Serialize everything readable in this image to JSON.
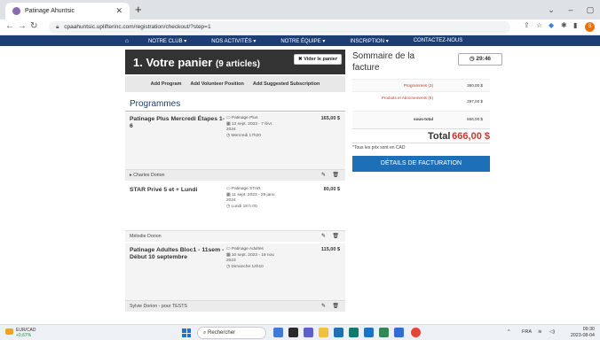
{
  "browser": {
    "tab_title": "Patinage Ahuntsic",
    "url": "cpaahuntsic.uplifterinc.com/registration/checkout/?step=1",
    "profile_initial": "S"
  },
  "site_nav": {
    "items": [
      "NOTRE CLUB",
      "NOS ACTIVITÉS",
      "NOTRE ÉQUIPE",
      "INSCRIPTION",
      "CONTACTEZ-NOUS"
    ],
    "dropdown_marker": "▾"
  },
  "cart": {
    "title": "1. Votre panier",
    "count": "(9 articles)",
    "empty_label": "Vider le panier",
    "actions": [
      "Add Program",
      "Add Volunteer Position",
      "Add Suggested Subscription"
    ],
    "section_title": "Programmes"
  },
  "programs": [
    {
      "name": "Patinage Plus Mercredi Étapes 1-6",
      "category": "Patinage Plus",
      "dates": "13 sept. 2023 - 7 févr. 2024",
      "schedule": "Mercredi 17h20",
      "price": "165,00 $",
      "person": "Charles Dorion",
      "has_toggle": true
    },
    {
      "name": "STAR Privé 5 et + Lundi",
      "category": "Patinage STAR",
      "dates": "11 sept. 2023 - 29 janv. 2024",
      "schedule": "Lundi 19 h 00",
      "price": "80,00 $",
      "person": "Mélodie Dorion",
      "has_toggle": false
    },
    {
      "name": "Patinage Adultes Bloc1 - 11sem - Début 10 septembre",
      "category": "Patinage Adultes",
      "dates": "10 sept. 2023 - 19 nov. 2023",
      "schedule": "Dimanche 14h10",
      "price": "115,00 $",
      "person": "Sylvie Dorion - pour TESTS",
      "has_toggle": false
    }
  ],
  "summary": {
    "title": "Sommaire de la facture",
    "timer": "29:46",
    "rows": [
      {
        "label": "Programmes (3)",
        "value": "360,00 $"
      },
      {
        "label": "Produits et Abonnements (6)",
        "value": "297,00 $"
      },
      {
        "label": "sous-total",
        "value": "666,00 $"
      }
    ],
    "total_label": "Total",
    "total_value": "666,00 $",
    "tax_note": "*Tous les prix sont en CAD",
    "billing_button": "DÉTAILS DE FACTURATION"
  },
  "taskbar": {
    "weather_title": "EUR/CAD",
    "weather_change": "+0,67%",
    "search_placeholder": "Rechercher",
    "language": "FRA",
    "time": "09:30",
    "date": "2023-08-04"
  },
  "colors": {
    "nav_bg": "#1d3e74",
    "accent_blue": "#1d6fb8",
    "price_red": "#c0392b",
    "cart_head_bg": "#333333"
  }
}
